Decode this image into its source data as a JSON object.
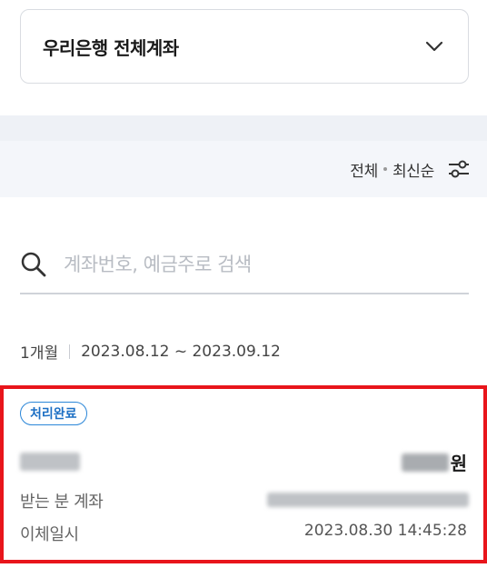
{
  "account_selector": {
    "title": "우리은행 전체계좌",
    "icon": "chevron-down-icon"
  },
  "filter": {
    "scope": "전체",
    "order": "최신순",
    "icon": "filter-sliders-icon"
  },
  "search": {
    "placeholder": "계좌번호, 예금주로 검색",
    "value": "",
    "icon": "search-icon"
  },
  "period": {
    "range_label": "1개월",
    "dates": "2023.08.12 ~ 2023.09.12"
  },
  "transactions": [
    {
      "status": "처리완료",
      "amount_unit": "원",
      "recipient_account_label": "받는 분 계좌",
      "transfer_time_label": "이체일시",
      "transfer_time": "2023.08.30 14:45:28"
    }
  ],
  "colors": {
    "highlight_border": "#e8151b",
    "badge": "#2a86d8",
    "band": "#eef1f6"
  }
}
